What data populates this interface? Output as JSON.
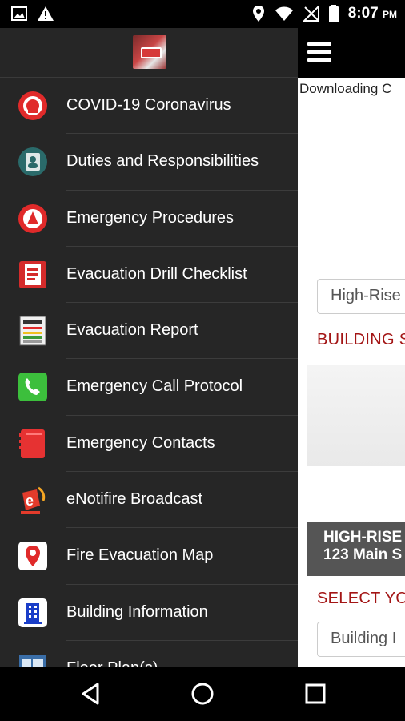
{
  "status_bar": {
    "time": "8:07",
    "ampm": "PM",
    "icons": [
      "image-icon",
      "warning-icon",
      "location-icon",
      "wifi-icon",
      "no-signal-icon",
      "battery-icon"
    ]
  },
  "page": {
    "downloading_text": "Downloading C",
    "dropdown_1": "High-Rise",
    "heading_1": "BUILDING S",
    "building_name": "HIGH-RISE",
    "building_address": "123 Main S",
    "heading_2": "SELECT YO",
    "dropdown_2": "Building I"
  },
  "drawer": {
    "items": [
      {
        "label": "COVID-19 Coronavirus",
        "icon": "covid-icon"
      },
      {
        "label": "Duties and Responsibilities",
        "icon": "duties-icon"
      },
      {
        "label": "Emergency Procedures",
        "icon": "procedures-icon"
      },
      {
        "label": "Evacuation Drill Checklist",
        "icon": "checklist-icon"
      },
      {
        "label": "Evacuation Report",
        "icon": "report-icon"
      },
      {
        "label": "Emergency Call Protocol",
        "icon": "phone-icon"
      },
      {
        "label": "Emergency Contacts",
        "icon": "contacts-icon"
      },
      {
        "label": "eNotifire Broadcast",
        "icon": "broadcast-icon"
      },
      {
        "label": "Fire Evacuation Map",
        "icon": "map-pin-icon"
      },
      {
        "label": "Building Information",
        "icon": "building-icon"
      },
      {
        "label": "Floor Plan(s)",
        "icon": "floor-plan-icon"
      }
    ]
  },
  "colors": {
    "drawer_bg": "#262626",
    "accent_red": "#a31515"
  }
}
